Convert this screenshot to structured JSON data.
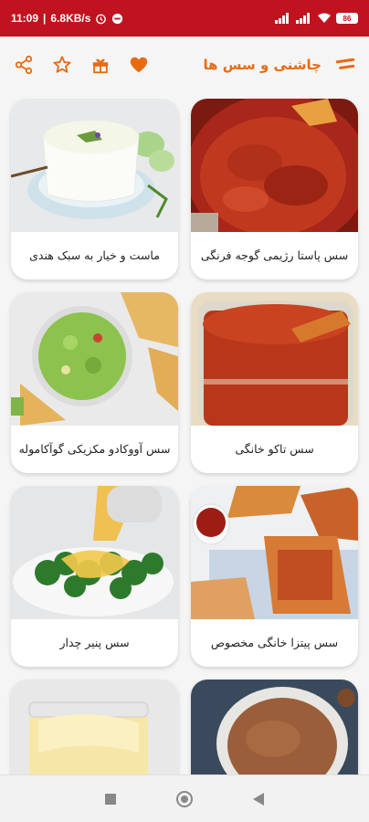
{
  "status_bar": {
    "time": "11:09",
    "speed": "6.8KB/s",
    "battery": "86"
  },
  "header": {
    "title": "چاشنی و سس ها"
  },
  "recipes": [
    {
      "label": "سس پاستا رژیمی گوجه فرنگی"
    },
    {
      "label": "ماست و خیار به سبک هندی"
    },
    {
      "label": "سس تاکو خانگی"
    },
    {
      "label": "سس آووکادو مکزیکی گوآکاموله"
    },
    {
      "label": "سس پیتزا خانگی مخصوص"
    },
    {
      "label": "سس پنیر چدار"
    },
    {
      "label": ""
    },
    {
      "label": ""
    }
  ],
  "colors": {
    "status_bar": "#c0131f",
    "accent": "#e86b12"
  }
}
